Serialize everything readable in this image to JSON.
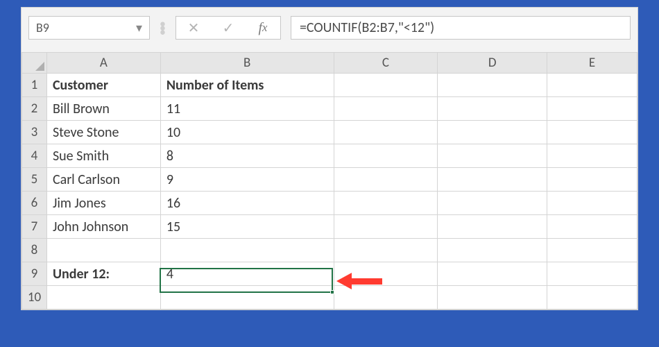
{
  "name_box": "B9",
  "formula": "=COUNTIF(B2:B7,\"<12\")",
  "columns": [
    "A",
    "B",
    "C",
    "D",
    "E"
  ],
  "row_count": 10,
  "active_cell": {
    "row": 9,
    "col": "B"
  },
  "headers": {
    "A": "Customer",
    "B": "Number of Items"
  },
  "rows": [
    {
      "A": "Bill Brown",
      "B": "11"
    },
    {
      "A": "Steve Stone",
      "B": "10"
    },
    {
      "A": "Sue Smith",
      "B": "8"
    },
    {
      "A": "Carl Carlson",
      "B": "9"
    },
    {
      "A": "Jim Jones",
      "B": "16"
    },
    {
      "A": "John Johnson",
      "B": "15"
    }
  ],
  "summary": {
    "label": "Under 12:",
    "value": "4"
  },
  "icons": {
    "dropdown": "▾",
    "cancel": "✕",
    "confirm": "✓"
  }
}
